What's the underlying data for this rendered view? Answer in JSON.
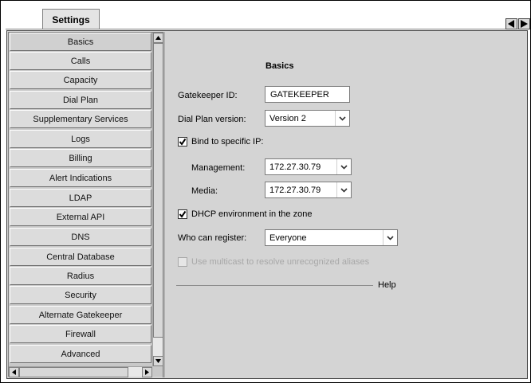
{
  "tab": {
    "label": "Settings"
  },
  "sidebar": {
    "items": [
      {
        "label": "Basics",
        "active": true
      },
      {
        "label": "Calls"
      },
      {
        "label": "Capacity"
      },
      {
        "label": "Dial Plan"
      },
      {
        "label": "Supplementary Services"
      },
      {
        "label": "Logs"
      },
      {
        "label": "Billing"
      },
      {
        "label": "Alert Indications"
      },
      {
        "label": "LDAP"
      },
      {
        "label": "External API"
      },
      {
        "label": "DNS"
      },
      {
        "label": "Central Database"
      },
      {
        "label": "Radius"
      },
      {
        "label": "Security"
      },
      {
        "label": "Alternate Gatekeeper"
      },
      {
        "label": "Firewall"
      },
      {
        "label": "Advanced"
      }
    ]
  },
  "main": {
    "title": "Basics",
    "gatekeeper_id": {
      "label": "Gatekeeper ID:",
      "value": "GATEKEEPER"
    },
    "dial_plan_version": {
      "label": "Dial Plan version:",
      "value": "Version 2"
    },
    "bind_ip": {
      "label": "Bind to specific IP:",
      "checked": true
    },
    "management": {
      "label": "Management:",
      "value": "172.27.30.79"
    },
    "media": {
      "label": "Media:",
      "value": "172.27.30.79"
    },
    "dhcp": {
      "label": "DHCP environment in the zone",
      "checked": true
    },
    "who_can_register": {
      "label": "Who can register:",
      "value": "Everyone"
    },
    "multicast": {
      "label": "Use multicast to resolve unrecognized aliases",
      "checked": false,
      "disabled": true
    },
    "help": {
      "label": "Help"
    }
  },
  "icons": {
    "nav_prev": "triangle-left-icon",
    "nav_next": "triangle-right-icon",
    "dropdown": "chevron-down-icon",
    "check": "checkmark-icon"
  },
  "colors": {
    "panel": "#d4d4d4",
    "sidebar_item": "#dcdcdc",
    "disabled_text": "#a8a8a8"
  }
}
